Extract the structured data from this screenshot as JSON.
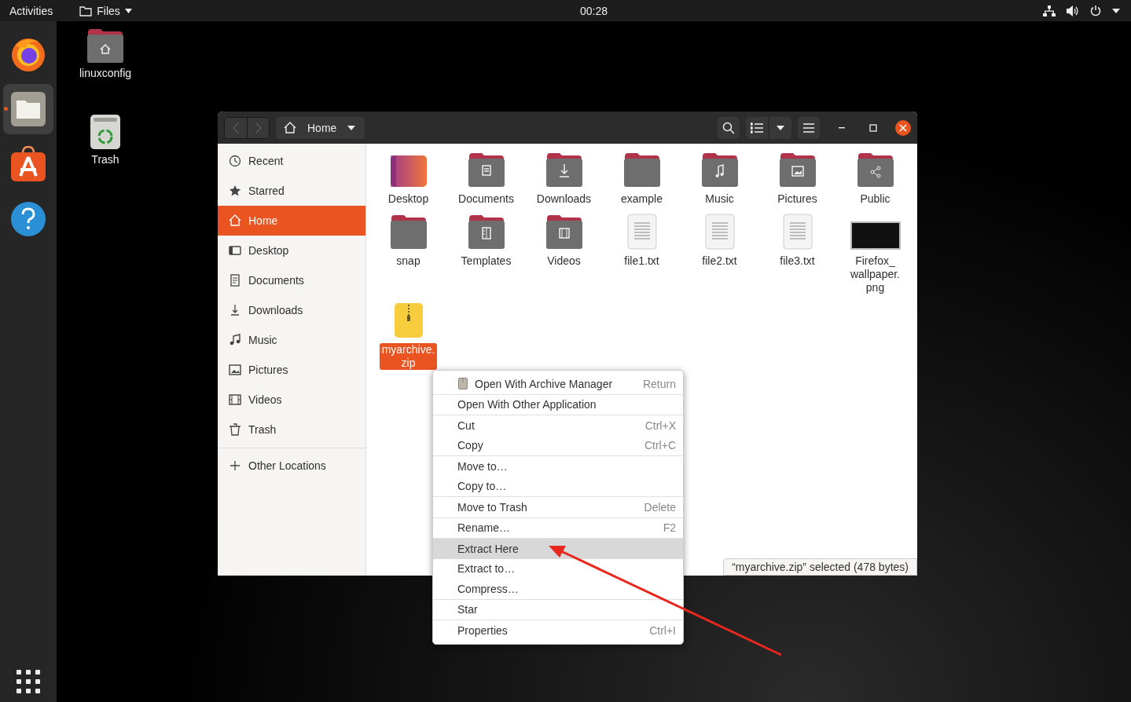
{
  "top_bar": {
    "activities": "Activities",
    "app_menu": "Files",
    "clock": "00:28"
  },
  "dock": [
    {
      "kind": "browser",
      "running": false
    },
    {
      "kind": "files",
      "running": true
    },
    {
      "kind": "store",
      "running": false
    },
    {
      "kind": "help",
      "running": false
    }
  ],
  "desktop_icons": [
    {
      "kind": "home",
      "label": "linuxconfig"
    },
    {
      "kind": "trash",
      "label": "Trash"
    }
  ],
  "window": {
    "location": "Home",
    "sidebar": [
      {
        "label": "Recent",
        "selected": false
      },
      {
        "label": "Starred",
        "selected": false
      },
      {
        "label": "Home",
        "selected": true
      },
      {
        "label": "Desktop",
        "selected": false
      },
      {
        "label": "Documents",
        "selected": false
      },
      {
        "label": "Downloads",
        "selected": false
      },
      {
        "label": "Music",
        "selected": false
      },
      {
        "label": "Pictures",
        "selected": false
      },
      {
        "label": "Videos",
        "selected": false
      },
      {
        "label": "Trash",
        "selected": false
      }
    ],
    "other_locations": "Other Locations",
    "files": [
      {
        "name": "Desktop",
        "kind": "desktop",
        "selected": false
      },
      {
        "name": "Documents",
        "kind": "folder",
        "selected": false
      },
      {
        "name": "Downloads",
        "kind": "folder",
        "selected": false
      },
      {
        "name": "example",
        "kind": "folder",
        "selected": false
      },
      {
        "name": "Music",
        "kind": "folder",
        "selected": false
      },
      {
        "name": "Pictures",
        "kind": "folder",
        "selected": false
      },
      {
        "name": "Public",
        "kind": "folder",
        "selected": false
      },
      {
        "name": "snap",
        "kind": "folder",
        "selected": false
      },
      {
        "name": "Templates",
        "kind": "folder",
        "selected": false
      },
      {
        "name": "Videos",
        "kind": "folder",
        "selected": false
      },
      {
        "name": "file1.txt",
        "kind": "text",
        "selected": false
      },
      {
        "name": "file2.txt",
        "kind": "text",
        "selected": false
      },
      {
        "name": "file3.txt",
        "kind": "text",
        "selected": false
      },
      {
        "name": "Firefox_ wallpaper. png",
        "kind": "image",
        "selected": false
      },
      {
        "name": "myarchive. zip",
        "kind": "archive",
        "selected": true
      }
    ],
    "status": "“myarchive.zip” selected  (478 bytes)"
  },
  "context_menu": [
    [
      {
        "label": "Open With Archive Manager",
        "shortcut": "Return",
        "has_icon": true,
        "selected": false
      }
    ],
    [
      {
        "label": "Open With Other Application",
        "selected": false
      }
    ],
    [
      {
        "label": "Cut",
        "shortcut": "Ctrl+X",
        "selected": false
      },
      {
        "label": "Copy",
        "shortcut": "Ctrl+C",
        "selected": false
      }
    ],
    [
      {
        "label": "Move to…",
        "selected": false
      },
      {
        "label": "Copy to…",
        "selected": false
      }
    ],
    [
      {
        "label": "Move to Trash",
        "shortcut": "Delete",
        "selected": false
      }
    ],
    [
      {
        "label": "Rename…",
        "shortcut": "F2",
        "selected": false
      }
    ],
    [
      {
        "label": "Extract Here",
        "selected": true
      },
      {
        "label": "Extract to…",
        "selected": false
      },
      {
        "label": "Compress…",
        "selected": false
      }
    ],
    [
      {
        "label": "Star",
        "selected": false
      }
    ],
    [
      {
        "label": "Properties",
        "shortcut": "Ctrl+I",
        "selected": false
      }
    ]
  ]
}
